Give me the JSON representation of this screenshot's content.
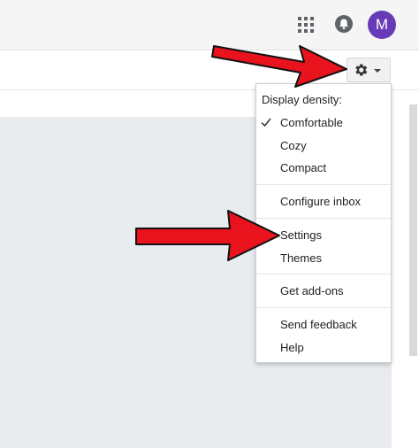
{
  "header": {
    "apps_icon": "apps-grid-icon",
    "notifications_icon": "notifications-bell-icon",
    "avatar_initial": "M",
    "avatar_color": "#673ab7"
  },
  "toolbar": {
    "settings_icon": "gear-icon",
    "dropdown_icon": "caret-down-icon"
  },
  "menu": {
    "header": "Display density:",
    "density_options": [
      {
        "label": "Comfortable",
        "checked": true
      },
      {
        "label": "Cozy",
        "checked": false
      },
      {
        "label": "Compact",
        "checked": false
      }
    ],
    "configure_inbox": "Configure inbox",
    "settings": "Settings",
    "themes": "Themes",
    "get_addons": "Get add-ons",
    "send_feedback": "Send feedback",
    "help": "Help"
  },
  "annotations": {
    "arrow_color": "#e8131d",
    "arrows": [
      "pointing-to-gear-button",
      "pointing-to-settings-item"
    ]
  }
}
